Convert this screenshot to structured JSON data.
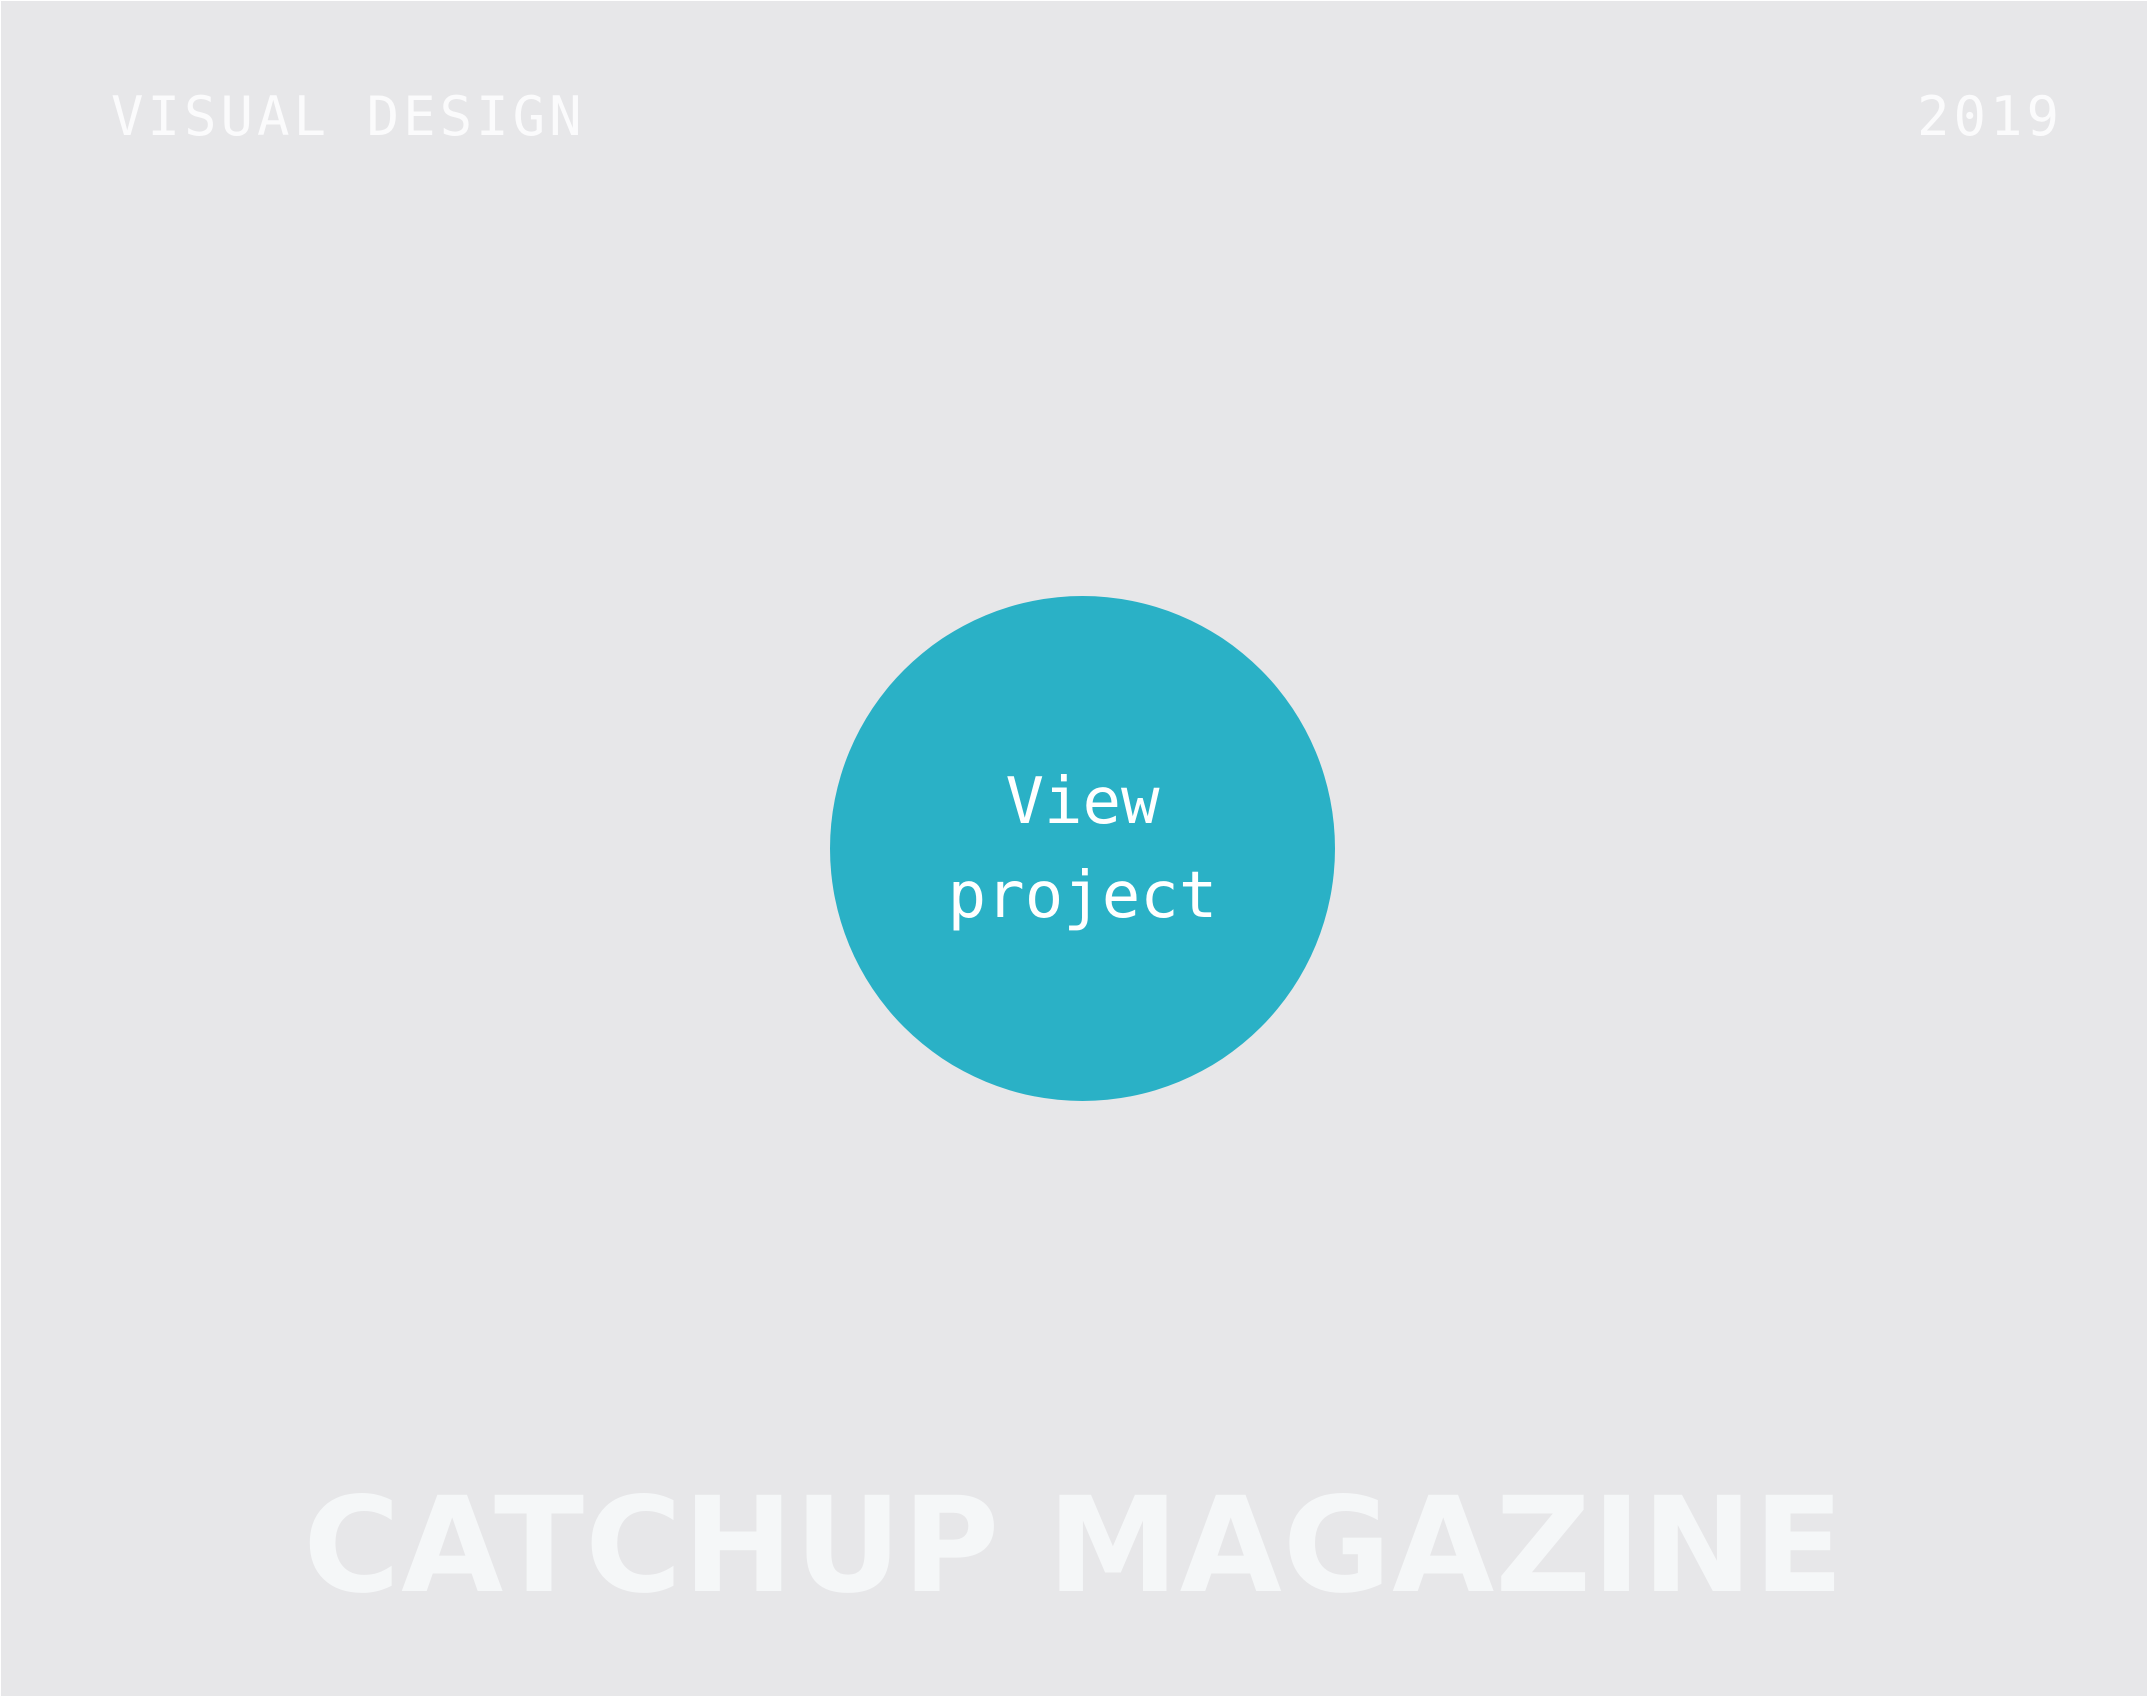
{
  "header": {
    "category": "VISUAL DESIGN",
    "year": "2019"
  },
  "cta": {
    "label": "View project"
  },
  "project": {
    "title": "CATCHUP MAGAZINE"
  },
  "colors": {
    "background": "#e7e7e9",
    "accent": "#2ab1c6",
    "text": "#ffffff"
  }
}
